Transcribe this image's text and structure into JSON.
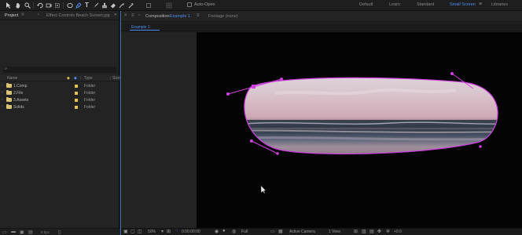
{
  "toolbar": {
    "auto_open_label": "Auto-Open",
    "workspaces": [
      "Default",
      "Learn",
      "Standard",
      "Small Screen",
      "Libraries"
    ],
    "active_workspace": "Small Screen"
  },
  "project_panel": {
    "tab_label": "Project",
    "effect_controls_label": "Effect Controls Beach Sunset.jpg",
    "columns": {
      "name": "Name",
      "type": "Type",
      "size": "Size"
    },
    "items": [
      {
        "name": "1.Comp",
        "type": "Folder"
      },
      {
        "name": "2.File",
        "type": "Folder"
      },
      {
        "name": "3.Assets",
        "type": "Folder"
      },
      {
        "name": "Solids",
        "type": "Folder"
      }
    ],
    "bpc": "8 bpc"
  },
  "comp_panel": {
    "composition_prefix": "Composition",
    "composition_name": "Example 1",
    "footage_label": "Footage (none)",
    "subtab_label": "Example 1"
  },
  "comp_footer": {
    "zoom": "50%",
    "timecode": "0:00:00:00",
    "resolution": "Full",
    "camera": "Active Camera",
    "view": "1 View",
    "exposure": "+0.0"
  },
  "colors": {
    "accent": "#4f8ef7",
    "mask_path": "#d040e0",
    "folder_label": "#e2c44d"
  }
}
